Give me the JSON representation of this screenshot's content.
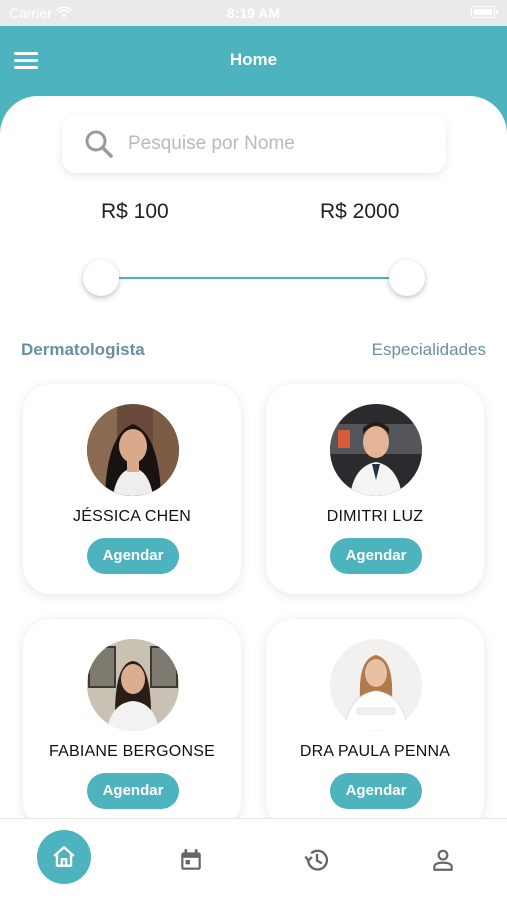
{
  "status_bar": {
    "carrier": "Carrier",
    "time": "8:19 AM"
  },
  "header": {
    "title": "Home",
    "menu_icon": "hamburger-menu-icon"
  },
  "search": {
    "placeholder": "Pesquise por Nome",
    "value": "",
    "icon": "search-icon"
  },
  "price_range": {
    "min_label": "R$ 100",
    "max_label": "R$ 2000"
  },
  "section": {
    "title": "Dermatologista",
    "link": "Especialidades"
  },
  "doctors": [
    {
      "name": "JÉSSICA CHEN",
      "button": "Agendar"
    },
    {
      "name": "DIMITRI LUZ",
      "button": "Agendar"
    },
    {
      "name": "FABIANE BERGONSE",
      "button": "Agendar"
    },
    {
      "name": "DRA PAULA PENNA",
      "button": "Agendar"
    }
  ],
  "tabbar": {
    "items": [
      "home-icon",
      "calendar-icon",
      "history-icon",
      "user-icon"
    ],
    "active": "home-icon"
  },
  "colors": {
    "accent": "#4db3be",
    "section_text": "#6b8fa1"
  }
}
